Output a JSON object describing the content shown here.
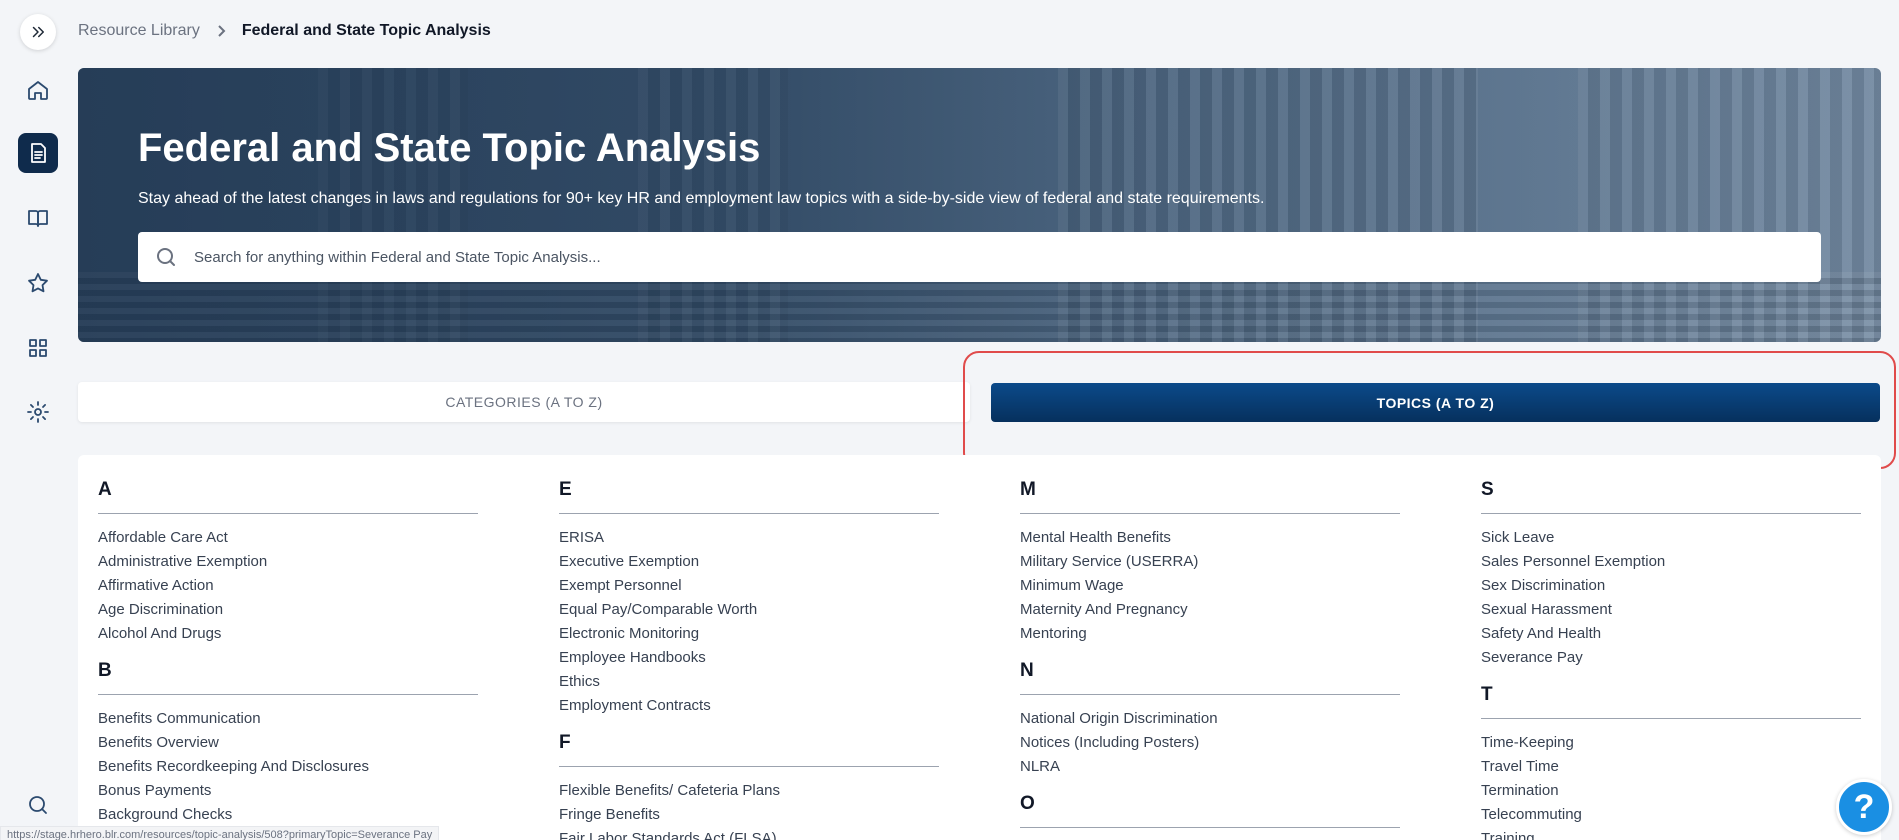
{
  "breadcrumb": {
    "parent": "Resource Library",
    "current": "Federal and State Topic Analysis"
  },
  "sidebar": {
    "items": [
      {
        "icon": "home-icon"
      },
      {
        "icon": "document-icon",
        "active": true
      },
      {
        "icon": "book-icon"
      },
      {
        "icon": "star-icon"
      },
      {
        "icon": "grid-icon"
      },
      {
        "icon": "gear-icon"
      },
      {
        "icon": "search-icon"
      }
    ]
  },
  "hero": {
    "title": "Federal and State Topic Analysis",
    "subtitle": "Stay ahead of the latest changes in laws and regulations for 90+ key HR and employment law topics with a side-by-side view of federal and state requirements.",
    "search_placeholder": "Search for anything within Federal and State Topic Analysis..."
  },
  "tabs": {
    "categories": "CATEGORIES (A TO Z)",
    "topics": "TOPICS (A TO Z)",
    "active": "topics"
  },
  "colors": {
    "accent": "#06305d",
    "highlight": "#e04b4b",
    "help": "#1a8fe3"
  },
  "columns": [
    [
      {
        "letter": "A",
        "topics": [
          "Affordable Care Act",
          "Administrative Exemption",
          "Affirmative Action",
          "Age Discrimination",
          "Alcohol And Drugs"
        ]
      },
      {
        "letter": "B",
        "topics": [
          "Benefits Communication",
          "Benefits Overview",
          "Benefits Recordkeeping And Disclosures",
          "Bonus Payments",
          "Background Checks"
        ]
      }
    ],
    [
      {
        "letter": "E",
        "topics": [
          "ERISA",
          "Executive Exemption",
          "Exempt Personnel",
          "Equal Pay/Comparable Worth",
          "Electronic Monitoring",
          "Employee Handbooks",
          "Ethics",
          "Employment Contracts"
        ]
      },
      {
        "letter": "F",
        "topics": [
          "Flexible Benefits/ Cafeteria Plans",
          "Fringe Benefits",
          "Fair Labor Standards Act (FLSA)"
        ]
      }
    ],
    [
      {
        "letter": "M",
        "topics": [
          "Mental Health Benefits",
          "Military Service (USERRA)",
          "Minimum Wage",
          "Maternity And Pregnancy",
          "Mentoring"
        ]
      },
      {
        "letter": "N",
        "topics": [
          "National Origin Discrimination",
          "Notices (Including Posters)",
          "NLRA"
        ]
      },
      {
        "letter": "O",
        "topics": []
      }
    ],
    [
      {
        "letter": "S",
        "topics": [
          "Sick Leave",
          "Sales Personnel Exemption",
          "Sex Discrimination",
          "Sexual Harassment",
          "Safety And Health",
          "Severance Pay"
        ]
      },
      {
        "letter": "T",
        "topics": [
          "Time-Keeping",
          "Travel Time",
          "Termination",
          "Telecommuting",
          "Training"
        ]
      }
    ]
  ],
  "help_label": "?",
  "status_url": "https://stage.hrhero.blr.com/resources/topic-analysis/508?primaryTopic=Severance Pay"
}
